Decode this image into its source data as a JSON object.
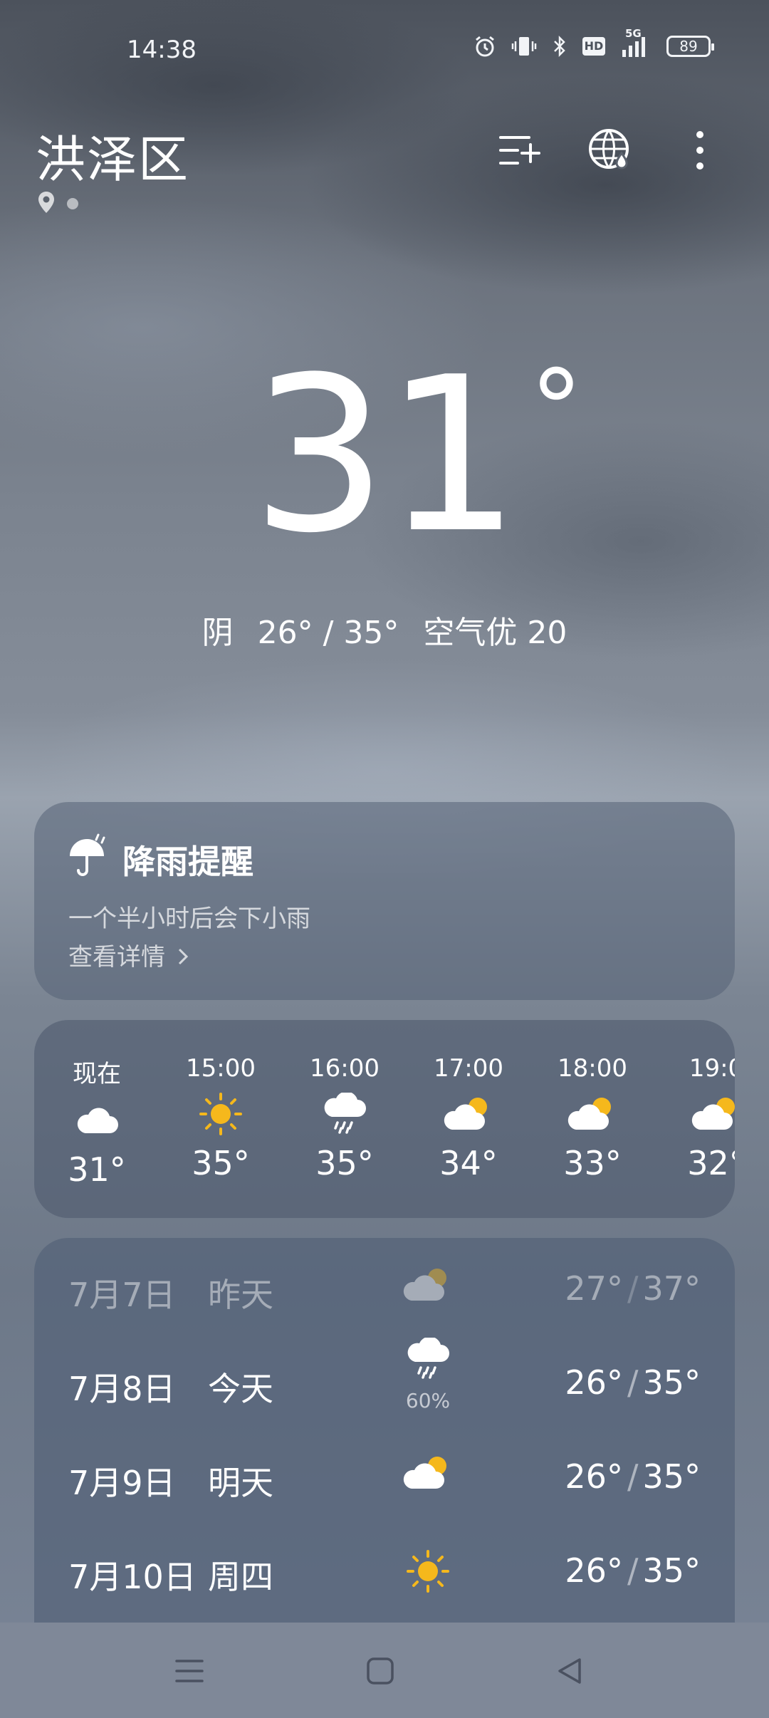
{
  "status_bar": {
    "time": "14:38",
    "battery": "89",
    "network": "5G",
    "hd": "HD"
  },
  "header": {
    "city": "洪泽区",
    "icons": [
      "location-pin-icon",
      "city-list-add-icon",
      "global-weather-icon",
      "more-icon"
    ]
  },
  "current": {
    "temperature": "31",
    "degree": "°",
    "condition": "阴",
    "range": "26° / 35°",
    "aqi": "空气优 20"
  },
  "rain_alert": {
    "title": "降雨提醒",
    "description": "一个半小时后会下小雨",
    "link": "查看详情"
  },
  "hourly": [
    {
      "time": "现在",
      "icon": "cloudy-icon",
      "temp": "31°"
    },
    {
      "time": "15:00",
      "icon": "sunny-icon",
      "temp": "35°"
    },
    {
      "time": "16:00",
      "icon": "rain-icon",
      "temp": "35°"
    },
    {
      "time": "17:00",
      "icon": "partly-cloudy-icon",
      "temp": "34°"
    },
    {
      "time": "18:00",
      "icon": "partly-cloudy-icon",
      "temp": "33°"
    },
    {
      "time": "19:0",
      "icon": "partly-cloudy-icon",
      "temp": "32°"
    }
  ],
  "daily": [
    {
      "date": "7月7日",
      "weekday": "昨天",
      "icon": "partly-cloudy-icon",
      "low": "27°",
      "high": "37°",
      "precip": ""
    },
    {
      "date": "7月8日",
      "weekday": "今天",
      "icon": "rain-icon",
      "low": "26°",
      "high": "35°",
      "precip": "60%"
    },
    {
      "date": "7月9日",
      "weekday": "明天",
      "icon": "partly-cloudy-icon",
      "low": "26°",
      "high": "35°",
      "precip": ""
    },
    {
      "date": "7月10日",
      "weekday": "周四",
      "icon": "sunny-icon",
      "low": "26°",
      "high": "35°",
      "precip": ""
    }
  ],
  "daily_sep": "/",
  "colors": {
    "sun": "#F5B81C",
    "text": "#FFFFFF",
    "card": "#566276"
  }
}
